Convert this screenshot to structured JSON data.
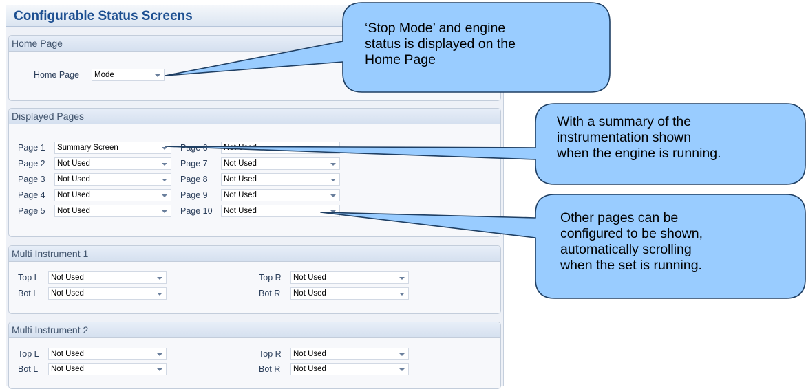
{
  "header": {
    "title": "Configurable Status Screens"
  },
  "home_group": {
    "title": "Home Page",
    "field_label": "Home Page",
    "value": "Mode"
  },
  "displayed_group": {
    "title": "Displayed Pages",
    "pages": [
      {
        "label": "Page 1",
        "value": "Summary Screen"
      },
      {
        "label": "Page 2",
        "value": "Not Used"
      },
      {
        "label": "Page 3",
        "value": "Not Used"
      },
      {
        "label": "Page 4",
        "value": "Not Used"
      },
      {
        "label": "Page 5",
        "value": "Not Used"
      },
      {
        "label": "Page 6",
        "value": "Not Used"
      },
      {
        "label": "Page 7",
        "value": "Not Used"
      },
      {
        "label": "Page 8",
        "value": "Not Used"
      },
      {
        "label": "Page 9",
        "value": "Not Used"
      },
      {
        "label": "Page 10",
        "value": "Not Used"
      }
    ]
  },
  "multi1": {
    "title": "Multi Instrument 1",
    "top_l": {
      "label": "Top L",
      "value": "Not Used"
    },
    "bot_l": {
      "label": "Bot L",
      "value": "Not Used"
    },
    "top_r": {
      "label": "Top R",
      "value": "Not Used"
    },
    "bot_r": {
      "label": "Bot R",
      "value": "Not Used"
    }
  },
  "multi2": {
    "title": "Multi Instrument 2",
    "top_l": {
      "label": "Top L",
      "value": "Not Used"
    },
    "bot_l": {
      "label": "Bot L",
      "value": "Not Used"
    },
    "top_r": {
      "label": "Top R",
      "value": "Not Used"
    },
    "bot_r": {
      "label": "Bot R",
      "value": "Not Used"
    }
  },
  "callouts": {
    "home": [
      "‘Stop Mode’ and engine",
      "status is displayed on the",
      "Home Page"
    ],
    "summary": [
      "With a summary of the",
      "instrumentation shown",
      "when the engine is running."
    ],
    "other": [
      "Other pages can be",
      "configured to be shown,",
      "automatically scrolling",
      "when the set is running."
    ]
  },
  "colors": {
    "callout_fill": "#99ccff",
    "title_text": "#1d4f91"
  }
}
